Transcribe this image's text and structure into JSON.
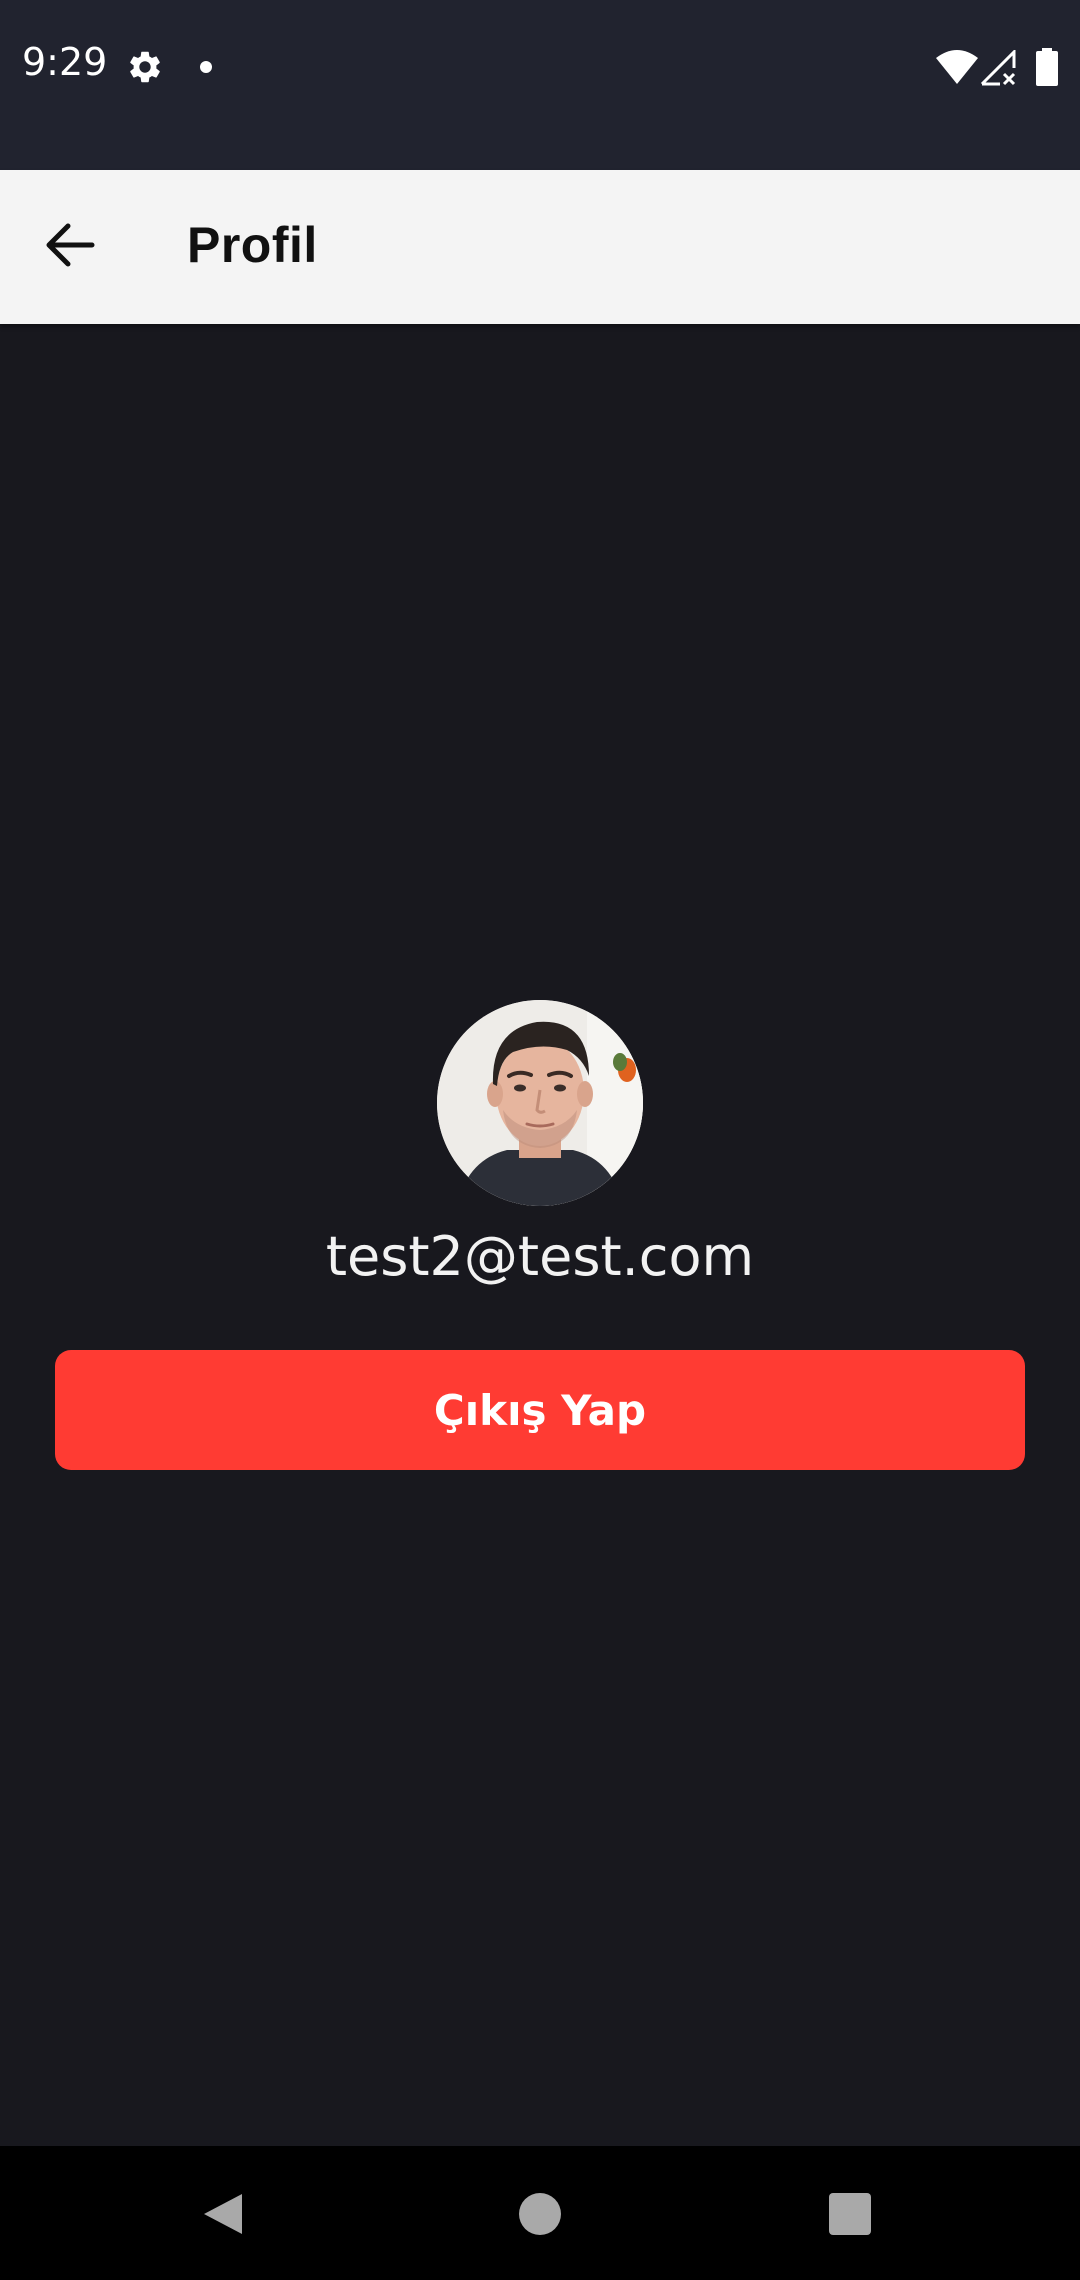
{
  "status_bar": {
    "time": "9:29",
    "icons": [
      "gear-icon",
      "notification-dot-icon",
      "wifi-icon",
      "signal-icon",
      "battery-icon"
    ]
  },
  "app_bar": {
    "back_icon": "arrow-left-icon",
    "title": "Profil"
  },
  "profile": {
    "avatar": "user-avatar-photo",
    "email": "test2@test.com"
  },
  "actions": {
    "logout_label": "Çıkış Yap"
  },
  "nav_bar": {
    "icons": [
      "back-triangle-icon",
      "home-circle-icon",
      "recents-square-icon"
    ]
  },
  "colors": {
    "status_bar_bg": "#21232f",
    "app_bar_bg": "#f4f4f4",
    "page_bg": "#18181e",
    "button_bg": "#ff3b33",
    "button_text": "#ffffff",
    "email_text": "#f2f2f2"
  }
}
